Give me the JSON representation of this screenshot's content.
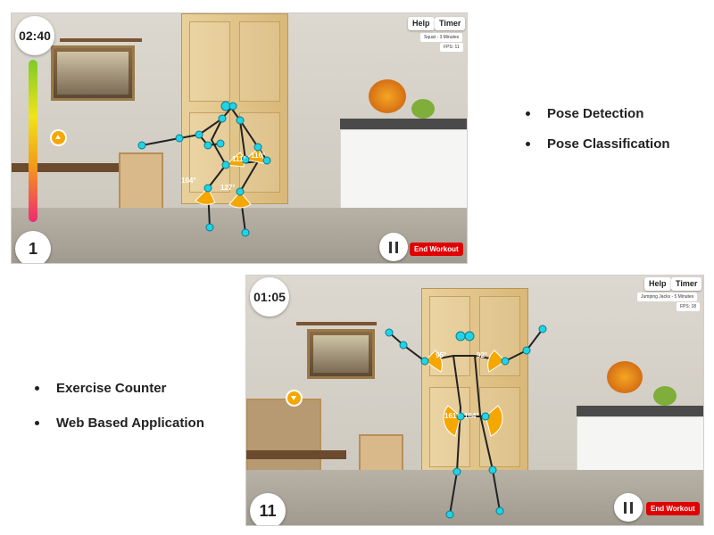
{
  "features_top": [
    {
      "label": "Pose Detection"
    },
    {
      "label": "Pose Classification"
    }
  ],
  "features_bottom": [
    {
      "label": "Exercise Counter"
    },
    {
      "label": "Web Based Application"
    }
  ],
  "screen_top": {
    "timer": "02:40",
    "rep_count": "1",
    "help_label": "Help",
    "timer_label": "Timer",
    "exercise_info": "Squat - 3 Minutes",
    "fps": "FPS: 11",
    "end_workout_label": "End Workout",
    "angles": [
      "111°",
      "116°",
      "104°",
      "127°"
    ],
    "marker_icon": "arrow-up-icon",
    "colors": {
      "progress_top": "#7ecb28",
      "progress_mid": "#f0e41a",
      "progress_bottom": "#ef2a73",
      "joint": "#22d3e6",
      "angle_arc": "#f5a700",
      "end_button": "#e00000"
    }
  },
  "screen_bottom": {
    "timer": "01:05",
    "rep_count": "11",
    "help_label": "Help",
    "timer_label": "Timer",
    "exercise_info": "Jumping Jacks - 5 Minutes",
    "fps": "FPS: 18",
    "end_workout_label": "End Workout",
    "angles": [
      "95°",
      "92°",
      "161°",
      "164°"
    ],
    "marker_icon": "arrow-down-icon"
  }
}
